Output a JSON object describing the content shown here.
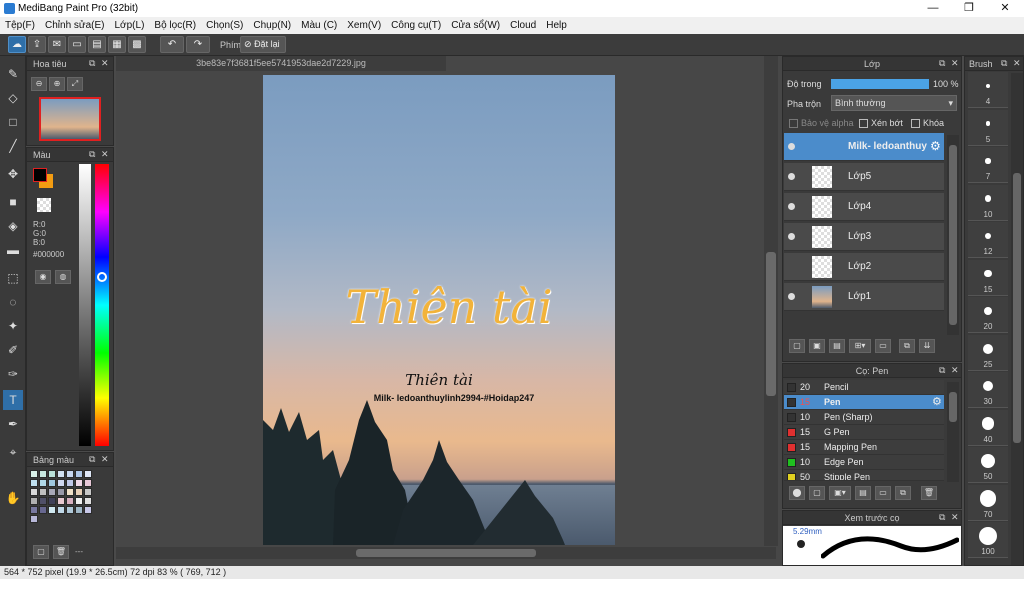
{
  "window": {
    "title": "MediBang Paint Pro (32bit)",
    "controls": {
      "minimize": "—",
      "restore": "❐",
      "close": "✕"
    }
  },
  "menu": [
    "Tệp(F)",
    "Chỉnh sửa(E)",
    "Lớp(L)",
    "Bộ lọc(R)",
    "Chọn(S)",
    "Chụp(N)",
    "Màu (C)",
    "Xem(V)",
    "Công cụ(T)",
    "Cửa sổ(W)",
    "Cloud",
    "Help"
  ],
  "toolbar": {
    "key_label": "Phím",
    "reset_label": "Đặt lại"
  },
  "canvas": {
    "tab_title": "3be83e7f3681f5ee5741953dae2d7229.jpg",
    "art_title": "Thiên tài",
    "art_subtitle": "Thiên tài",
    "art_caption": "Milk- ledoanthuylinh2994-#Hoidap247"
  },
  "navigator": {
    "title": "Hoa tiêu"
  },
  "color_panel": {
    "title": "Màu",
    "r": "R:0",
    "g": "G:0",
    "b": "B:0",
    "hex": "#000000",
    "fg": "#000000",
    "bg": "#f39c12"
  },
  "palette": {
    "title": "Bảng màu",
    "colors": [
      "#d8f0e8",
      "#c8e8e0",
      "#b8e0d8",
      "#d0e0f0",
      "#c8d8f0",
      "#b0c8e8",
      "#e0e8f8",
      "#c0e0f0",
      "#b0d8e8",
      "#a0c8e0",
      "#d0d8f0",
      "#c0c8e8",
      "#f0d8e8",
      "#e8c8d8",
      "#d8d8d8",
      "#c0c0c0",
      "#a8a8b8",
      "#9898a8",
      "#f0e0c8",
      "#e8d0b8",
      "#c8c8c8",
      "#b0b0b0",
      "#505068",
      "#404058",
      "#e8c8d0",
      "#d8b0c0",
      "#f0f0f0",
      "#e0e0e0",
      "#7878a0",
      "#686890",
      "#d0e8f0",
      "#c0d8e8",
      "#b0c8d8",
      "#a0b8c8",
      "#c8c8e8",
      "#b8b8d8"
    ],
    "more": "---"
  },
  "layers_panel": {
    "title": "Lớp",
    "opacity_label": "Độ trong",
    "opacity_value": "100 %",
    "opacity_fraction": 1.0,
    "blend_label": "Pha trộn",
    "blend_value": "Bình thường",
    "protect_alpha": "Bảo vệ alpha",
    "clipping": "Xén bớt",
    "lock": "Khóa",
    "layers": [
      {
        "name": "Milk- ledoanthuy",
        "selected": true,
        "visible": true
      },
      {
        "name": "Lớp5",
        "selected": false,
        "visible": true
      },
      {
        "name": "Lớp4",
        "selected": false,
        "visible": true
      },
      {
        "name": "Lớp3",
        "selected": false,
        "visible": true
      },
      {
        "name": "Lớp2",
        "selected": false,
        "visible": false
      },
      {
        "name": "Lớp1",
        "selected": false,
        "visible": true
      }
    ]
  },
  "brush_panel": {
    "title": "Cọ: Pen",
    "brushes": [
      {
        "size": "20",
        "name": "Pencil",
        "color": "#333333"
      },
      {
        "size": "15",
        "name": "Pen",
        "color": "#333333",
        "selected": true
      },
      {
        "size": "10",
        "name": "Pen (Sharp)",
        "color": "#333333"
      },
      {
        "size": "15",
        "name": "G Pen",
        "color": "#e03030"
      },
      {
        "size": "15",
        "name": "Mapping Pen",
        "color": "#e03030"
      },
      {
        "size": "10",
        "name": "Edge Pen",
        "color": "#20c020"
      },
      {
        "size": "50",
        "name": "Stipple Pen",
        "color": "#e0d020"
      }
    ]
  },
  "preview_panel": {
    "title": "Xem trước cọ",
    "size_label": "5.29mm"
  },
  "brush_sizes": {
    "title": "Brush",
    "sizes": [
      "4",
      "5",
      "7",
      "10",
      "12",
      "15",
      "20",
      "25",
      "30",
      "40",
      "50",
      "70",
      "100"
    ]
  },
  "status": {
    "text": "564 * 752 pixel   (19.9 * 26.5cm)   72 dpi   83 %   ( 769, 712 )"
  }
}
